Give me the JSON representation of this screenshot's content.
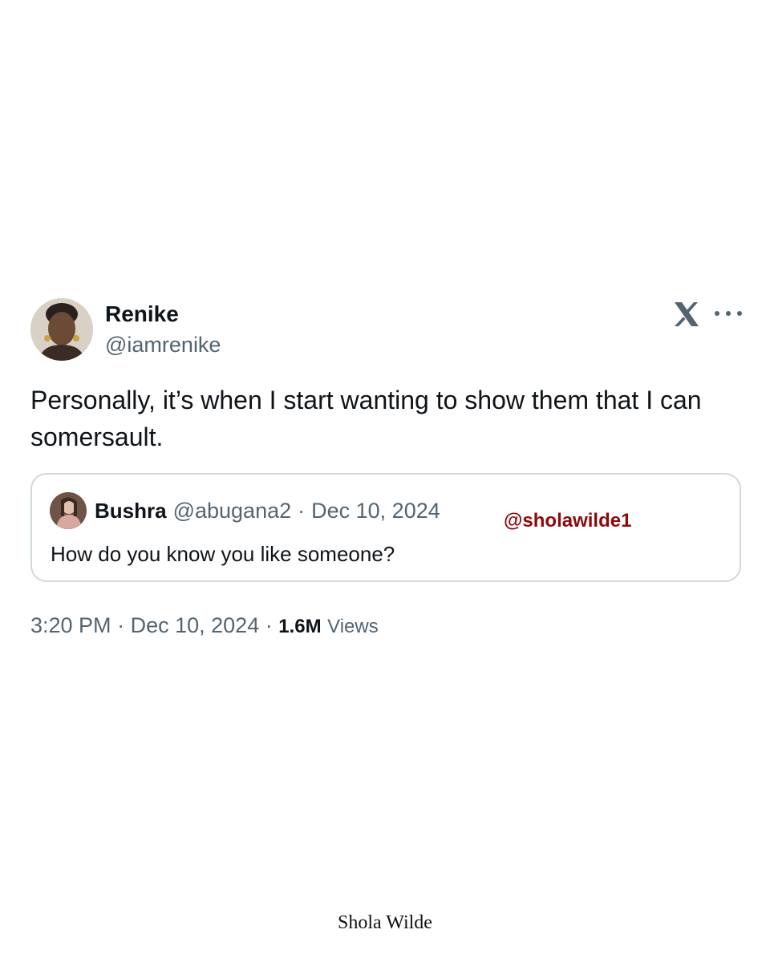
{
  "tweet": {
    "display_name": "Renike",
    "handle": "@iamrenike",
    "text": "Personally, it’s when I start wanting to show them that I can somersault.",
    "quote": {
      "display_name": "Bushra",
      "handle": "@abugana2",
      "separator": "·",
      "date": "Dec 10, 2024",
      "text": "How do you know you like someone?"
    },
    "meta": {
      "time": "3:20 PM",
      "separator1": "·",
      "date": "Dec 10, 2024",
      "separator2": "·",
      "views_count": "1.6M",
      "views_label": "Views"
    }
  },
  "watermark": "@sholawilde1",
  "footer": "Shola Wilde",
  "icons": {
    "brand": "x-logo-icon",
    "menu": "more-icon"
  },
  "colors": {
    "text_primary": "#0f1419",
    "text_secondary": "#536471",
    "border": "#cfd9de",
    "watermark": "#8b0a0a"
  }
}
